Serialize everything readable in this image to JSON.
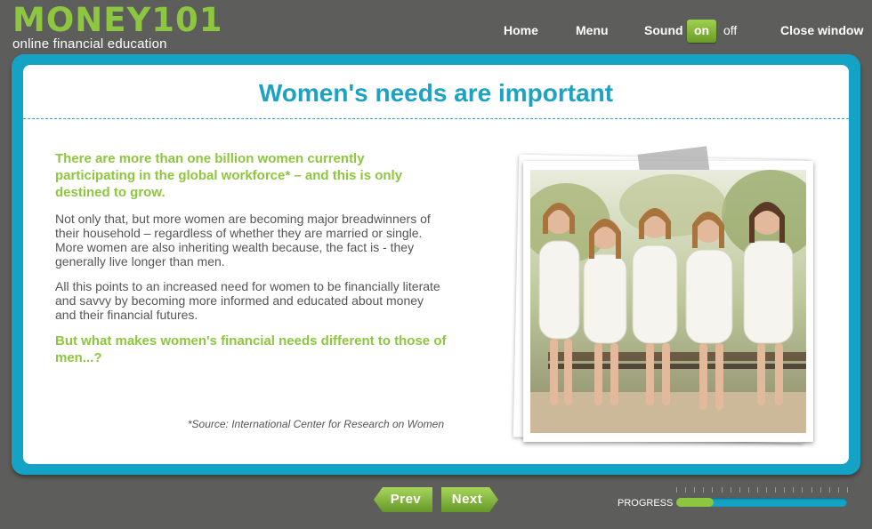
{
  "logo": {
    "main": "MONEY101",
    "tagline": "online financial education"
  },
  "nav": {
    "home": "Home",
    "menu": "Menu",
    "sound_label": "Sound",
    "sound_on": "on",
    "sound_off": "off",
    "close": "Close window"
  },
  "content": {
    "title": "Women's needs are important",
    "lead": "There are more than one billion women currently participating in the global workforce* – and this is only destined to grow.",
    "paragraph1": "Not only that, but more women are becoming major breadwinners of their household – regardless of whether they are married or single. More women are also inheriting wealth because, the fact is - they generally live longer than men.",
    "paragraph2": "All this points to an increased need for women to be financially literate and savvy by becoming more informed and educated about money and their financial futures.",
    "question": "But what makes women's financial needs different to those of men...?",
    "source": "*Source: International Center for Research on Women"
  },
  "footer": {
    "prev": "Prev",
    "next": "Next",
    "progress_label": "PROGRESS",
    "progress_fraction": 0.22
  },
  "colors": {
    "brand_green": "#8dc63f",
    "accent_blue": "#15a3c5",
    "background": "#5d5d5b"
  }
}
